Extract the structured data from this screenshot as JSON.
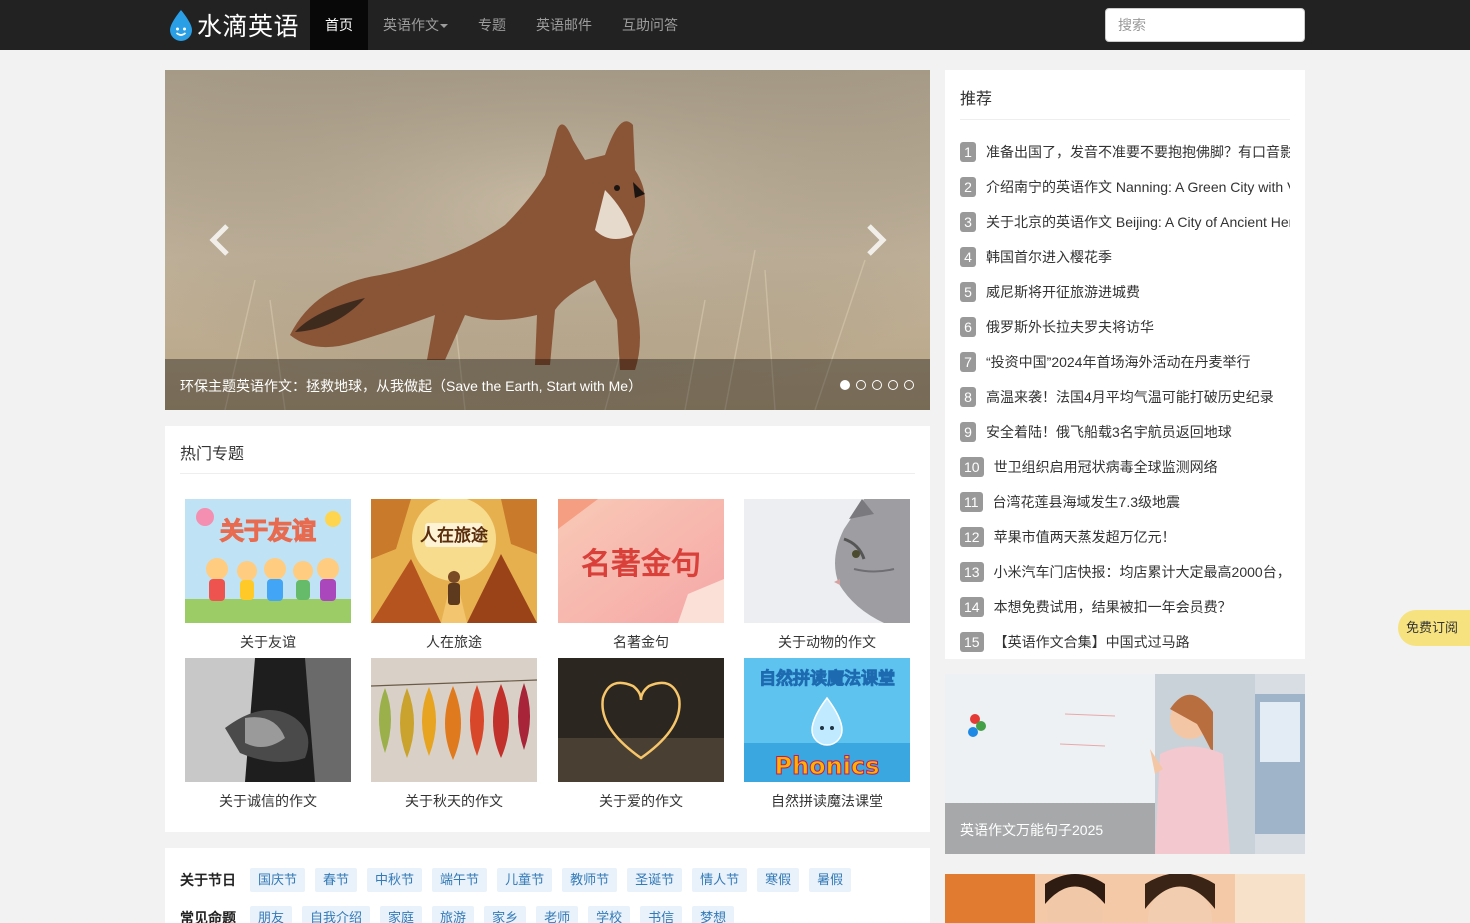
{
  "brand": {
    "name": "水滴英语"
  },
  "nav": {
    "items": [
      {
        "label": "首页"
      },
      {
        "label": "英语作文"
      },
      {
        "label": "专题"
      },
      {
        "label": "英语邮件"
      },
      {
        "label": "互助问答"
      }
    ]
  },
  "search": {
    "placeholder": "搜索"
  },
  "carousel": {
    "caption": "环保主题英语作文：拯救地球，从我做起（Save the Earth, Start with Me）",
    "slide_count": 5,
    "active_index": 0
  },
  "topics": {
    "title": "热门专题",
    "items": [
      {
        "label": "关于友谊"
      },
      {
        "label": "人在旅途"
      },
      {
        "label": "名著金句"
      },
      {
        "label": "关于动物的作文"
      },
      {
        "label": "关于诚信的作文"
      },
      {
        "label": "关于秋天的作文"
      },
      {
        "label": "关于爱的作文"
      },
      {
        "label": "自然拼读魔法课堂"
      }
    ],
    "thumb_texts": {
      "friendship": "关于友谊",
      "travel": "人在旅途",
      "quotes": "名著金句",
      "phonics_title": "自然拼读魔法课堂",
      "phonics_word": "Phonics"
    }
  },
  "recommend": {
    "title": "推荐",
    "items": [
      {
        "num": "1",
        "text": "准备出国了，发音不准要不要抱抱佛脚？有口音影"
      },
      {
        "num": "2",
        "text": "介绍南宁的英语作文 Nanning: A Green City with V"
      },
      {
        "num": "3",
        "text": "关于北京的英语作文 Beijing: A City of Ancient Her"
      },
      {
        "num": "4",
        "text": "韩国首尔进入樱花季"
      },
      {
        "num": "5",
        "text": "威尼斯将开征旅游进城费"
      },
      {
        "num": "6",
        "text": "俄罗斯外长拉夫罗夫将访华"
      },
      {
        "num": "7",
        "text": "“投资中国”2024年首场海外活动在丹麦举行"
      },
      {
        "num": "8",
        "text": "高温来袭！法国4月平均气温可能打破历史纪录"
      },
      {
        "num": "9",
        "text": "安全着陆！俄飞船载3名宇航员返回地球"
      },
      {
        "num": "10",
        "text": "世卫组织启用冠状病毒全球监测网络"
      },
      {
        "num": "11",
        "text": "台湾花莲县海域发生7.3级地震"
      },
      {
        "num": "12",
        "text": "苹果市值两天蒸发超万亿元！"
      },
      {
        "num": "13",
        "text": "小米汽车门店快报：均店累计大定最高2000台，"
      },
      {
        "num": "14",
        "text": "本想免费试用，结果被扣一年会员费？"
      },
      {
        "num": "15",
        "text": "【英语作文合集】中国式过马路"
      }
    ]
  },
  "ad": {
    "caption": "英语作文万能句子2025"
  },
  "tags": {
    "rows": [
      {
        "head": "关于节日",
        "tags": [
          "国庆节",
          "春节",
          "中秋节",
          "端午节",
          "儿童节",
          "教师节",
          "圣诞节",
          "情人节",
          "寒假",
          "暑假"
        ]
      },
      {
        "head": "常见命题",
        "tags": [
          "朋友",
          "自我介绍",
          "家庭",
          "旅游",
          "家乡",
          "老师",
          "学校",
          "书信",
          "梦想"
        ]
      }
    ]
  },
  "subscribe": {
    "label": "免费订阅"
  },
  "colors": {
    "navbar": "#222222",
    "accent_link": "#337ab7",
    "badge": "#999999",
    "subscribe": "#f6e27f"
  }
}
